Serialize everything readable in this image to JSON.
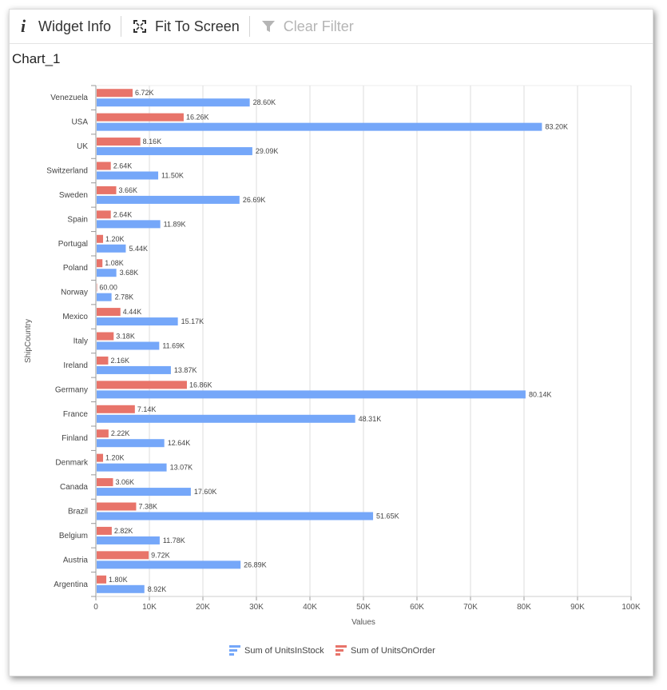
{
  "toolbar": {
    "widget_info": "Widget Info",
    "fit_to_screen": "Fit To Screen",
    "clear_filter": "Clear Filter"
  },
  "chart_title": "Chart_1",
  "chart_data": {
    "type": "bar",
    "orientation": "horizontal",
    "xlabel": "Values",
    "ylabel": "ShipCountry",
    "xlim": [
      0,
      100000
    ],
    "x_ticks": [
      "0",
      "10K",
      "20K",
      "30K",
      "40K",
      "50K",
      "60K",
      "70K",
      "80K",
      "90K",
      "100K"
    ],
    "grid": true,
    "legend_position": "bottom",
    "categories": [
      "Venezuela",
      "USA",
      "UK",
      "Switzerland",
      "Sweden",
      "Spain",
      "Portugal",
      "Poland",
      "Norway",
      "Mexico",
      "Italy",
      "Ireland",
      "Germany",
      "France",
      "Finland",
      "Denmark",
      "Canada",
      "Brazil",
      "Belgium",
      "Austria",
      "Argentina"
    ],
    "series": [
      {
        "name": "Sum of UnitsInStock",
        "color": "#75a7f9",
        "values": [
          28600,
          83200,
          29090,
          11500,
          26690,
          11890,
          5440,
          3680,
          2780,
          15170,
          11690,
          13870,
          80140,
          48310,
          12640,
          13070,
          17600,
          51650,
          11780,
          26890,
          8920
        ],
        "labels": [
          "28.60K",
          "83.20K",
          "29.09K",
          "11.50K",
          "26.69K",
          "11.89K",
          "5.44K",
          "3.68K",
          "2.78K",
          "15.17K",
          "11.69K",
          "13.87K",
          "80.14K",
          "48.31K",
          "12.64K",
          "13.07K",
          "17.60K",
          "51.65K",
          "11.78K",
          "26.89K",
          "8.92K"
        ]
      },
      {
        "name": "Sum of UnitsOnOrder",
        "color": "#e8746a",
        "values": [
          6720,
          16260,
          8160,
          2640,
          3660,
          2640,
          1200,
          1080,
          60,
          4440,
          3180,
          2160,
          16860,
          7140,
          2220,
          1200,
          3060,
          7380,
          2820,
          9720,
          1800
        ],
        "labels": [
          "6.72K",
          "16.26K",
          "8.16K",
          "2.64K",
          "3.66K",
          "2.64K",
          "1.20K",
          "1.08K",
          "60.00",
          "4.44K",
          "3.18K",
          "2.16K",
          "16.86K",
          "7.14K",
          "2.22K",
          "1.20K",
          "3.06K",
          "7.38K",
          "2.82K",
          "9.72K",
          "1.80K"
        ]
      }
    ]
  }
}
